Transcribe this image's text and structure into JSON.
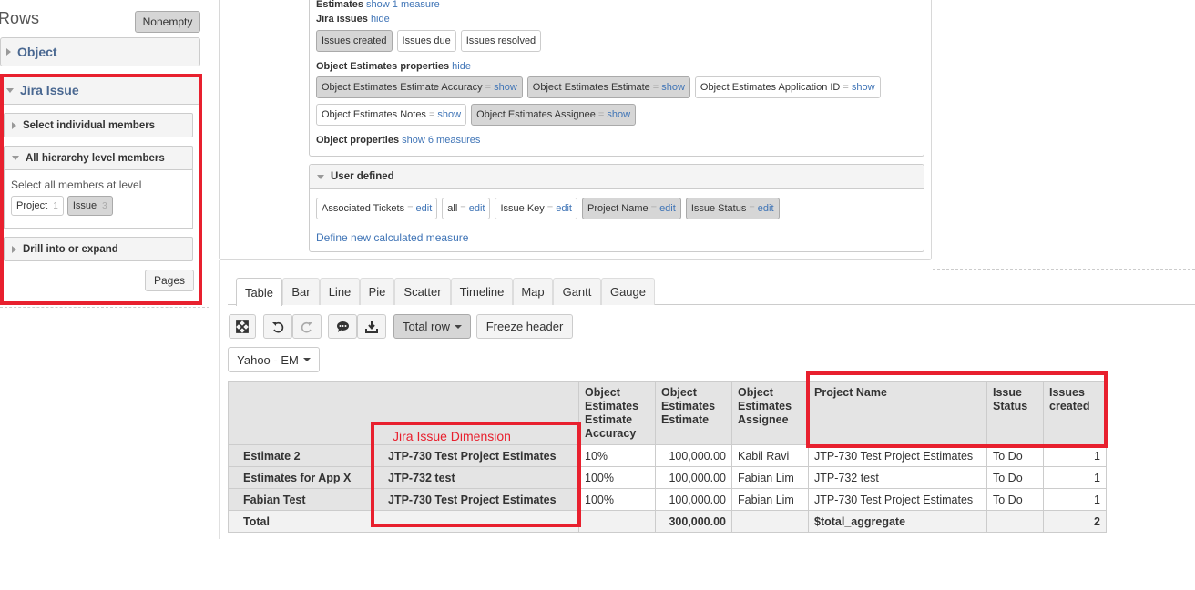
{
  "rows_panel": {
    "title": "Rows",
    "nonempty_label": "Nonempty",
    "object_label": "Object",
    "jira_issue_label": "Jira Issue",
    "select_individual_label": "Select individual members",
    "all_hierarchy_label": "All hierarchy level members",
    "select_all_text": "Select all members at level",
    "levels": [
      {
        "label": "Project",
        "count": "1",
        "selected": false
      },
      {
        "label": "Issue",
        "count": "3",
        "selected": true
      }
    ],
    "drill_label": "Drill into or expand",
    "pages_label": "Pages"
  },
  "measures": {
    "estimates_label": "Estimates",
    "estimates_link": "show 1 measure",
    "jira_issues_label": "Jira issues",
    "jira_issues_link": "hide",
    "jira_chips": [
      {
        "label": "Issues created",
        "selected": true
      },
      {
        "label": "Issues due",
        "selected": false
      },
      {
        "label": "Issues resolved",
        "selected": false
      }
    ],
    "obj_est_props_label": "Object Estimates properties",
    "obj_est_props_link": "hide",
    "obj_chips_row1": [
      {
        "label": "Object Estimates Estimate Accuracy",
        "eq": "=",
        "link": "show",
        "selected": true
      },
      {
        "label": "Object Estimates Estimate",
        "eq": "=",
        "link": "show",
        "selected": true
      },
      {
        "label": "Object Estimates Application ID",
        "eq": "=",
        "link": "show",
        "selected": false
      }
    ],
    "obj_chips_row2": [
      {
        "label": "Object Estimates Notes",
        "eq": "=",
        "link": "show",
        "selected": false
      },
      {
        "label": "Object Estimates Assignee",
        "eq": "=",
        "link": "show",
        "selected": true
      }
    ],
    "object_props_label": "Object properties",
    "object_props_link": "show 6 measures",
    "user_defined_label": "User defined",
    "user_chips": [
      {
        "label": "Associated Tickets",
        "eq": "=",
        "link": "edit",
        "selected": false
      },
      {
        "label": "all",
        "eq": "=",
        "link": "edit",
        "selected": false
      },
      {
        "label": "Issue Key",
        "eq": "=",
        "link": "edit",
        "selected": false
      },
      {
        "label": "Project Name",
        "eq": "=",
        "link": "edit",
        "selected": true
      },
      {
        "label": "Issue Status",
        "eq": "=",
        "link": "edit",
        "selected": true
      }
    ],
    "define_link": "Define new calculated measure"
  },
  "tabs": [
    "Table",
    "Bar",
    "Line",
    "Pie",
    "Scatter",
    "Timeline",
    "Map",
    "Gantt",
    "Gauge"
  ],
  "active_tab": "Table",
  "toolbar": {
    "total_row_label": "Total row",
    "freeze_header_label": "Freeze header",
    "view_label": "Yahoo - EM"
  },
  "annotation": "Jira Issue  Dimension",
  "table": {
    "headers": [
      "Object Estimates Estimate Accuracy",
      "Object Estimates Estimate",
      "Object Estimates Assignee",
      "Project Name",
      "Issue Status",
      "Issues created"
    ],
    "rows": [
      {
        "h1": "Estimate 2",
        "h2": "JTP-730 Test Project Estimates",
        "cells": [
          "10%",
          "100,000.00",
          "Kabil Ravi",
          "JTP-730 Test Project Estimates",
          "To Do",
          "1"
        ]
      },
      {
        "h1": "Estimates for App X",
        "h2": "JTP-732 test",
        "cells": [
          "100%",
          "100,000.00",
          "Fabian Lim",
          "JTP-732 test",
          "To Do",
          "1"
        ]
      },
      {
        "h1": "Fabian Test",
        "h2": "JTP-730 Test Project Estimates",
        "cells": [
          "100%",
          "100,000.00",
          "Fabian Lim",
          "JTP-730 Test Project Estimates",
          "To Do",
          "1"
        ]
      }
    ],
    "total": {
      "label": "Total",
      "cells": [
        "",
        "300,000.00",
        "",
        "$total_aggregate",
        "",
        "2"
      ]
    }
  }
}
